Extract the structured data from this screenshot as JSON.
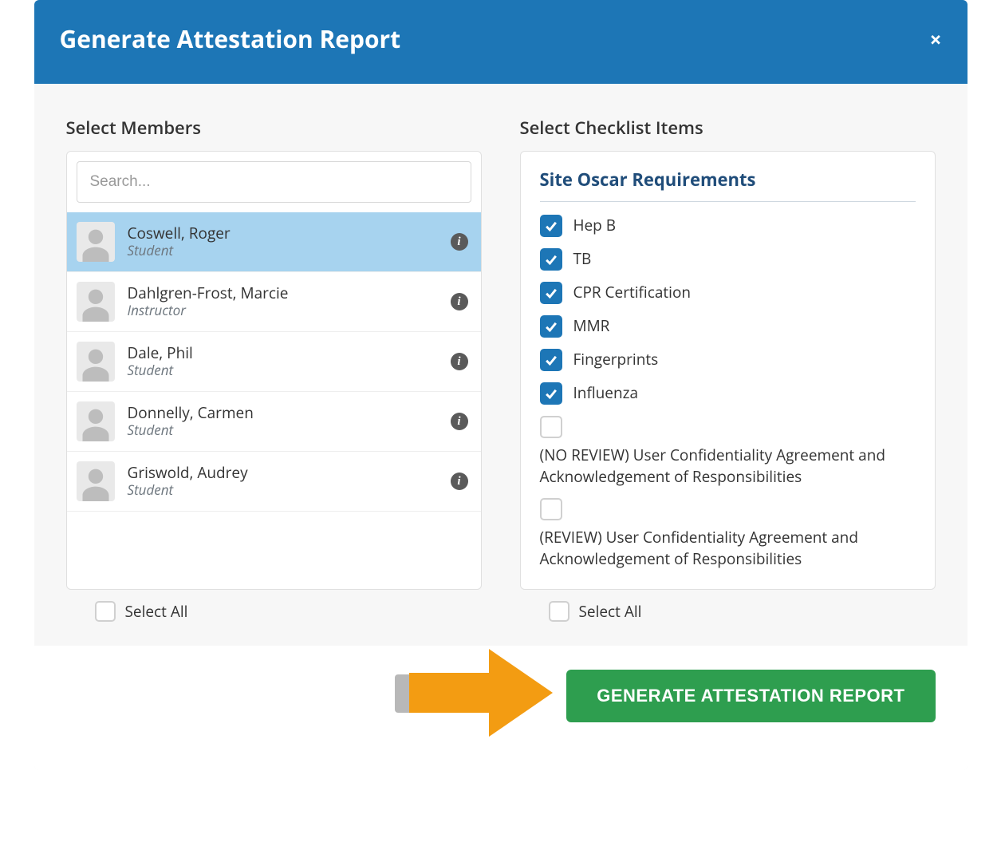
{
  "modal": {
    "title": "Generate Attestation Report",
    "close": "×"
  },
  "members": {
    "label": "Select Members",
    "search_placeholder": "Search...",
    "list": [
      {
        "name": "Coswell, Roger",
        "role": "Student",
        "selected": true
      },
      {
        "name": "Dahlgren-Frost, Marcie",
        "role": "Instructor",
        "selected": false
      },
      {
        "name": "Dale, Phil",
        "role": "Student",
        "selected": false
      },
      {
        "name": "Donnelly, Carmen",
        "role": "Student",
        "selected": false
      },
      {
        "name": "Griswold, Audrey",
        "role": "Student",
        "selected": false
      }
    ],
    "select_all": "Select All"
  },
  "checklist": {
    "label": "Select Checklist Items",
    "group_title": "Site Oscar Requirements",
    "items": [
      {
        "label": "Hep B",
        "checked": true
      },
      {
        "label": "TB",
        "checked": true
      },
      {
        "label": "CPR Certification",
        "checked": true
      },
      {
        "label": "MMR",
        "checked": true
      },
      {
        "label": "Fingerprints",
        "checked": true
      },
      {
        "label": "Influenza",
        "checked": true
      },
      {
        "label": "(NO REVIEW) User Confidentiality Agreement and Acknowledgement of Responsibilities",
        "checked": false
      },
      {
        "label": "(REVIEW) User Confidentiality Agreement and Acknowledgement of Responsibilities",
        "checked": false
      }
    ],
    "select_all": "Select All"
  },
  "footer": {
    "generate": "GENERATE ATTESTATION REPORT"
  }
}
